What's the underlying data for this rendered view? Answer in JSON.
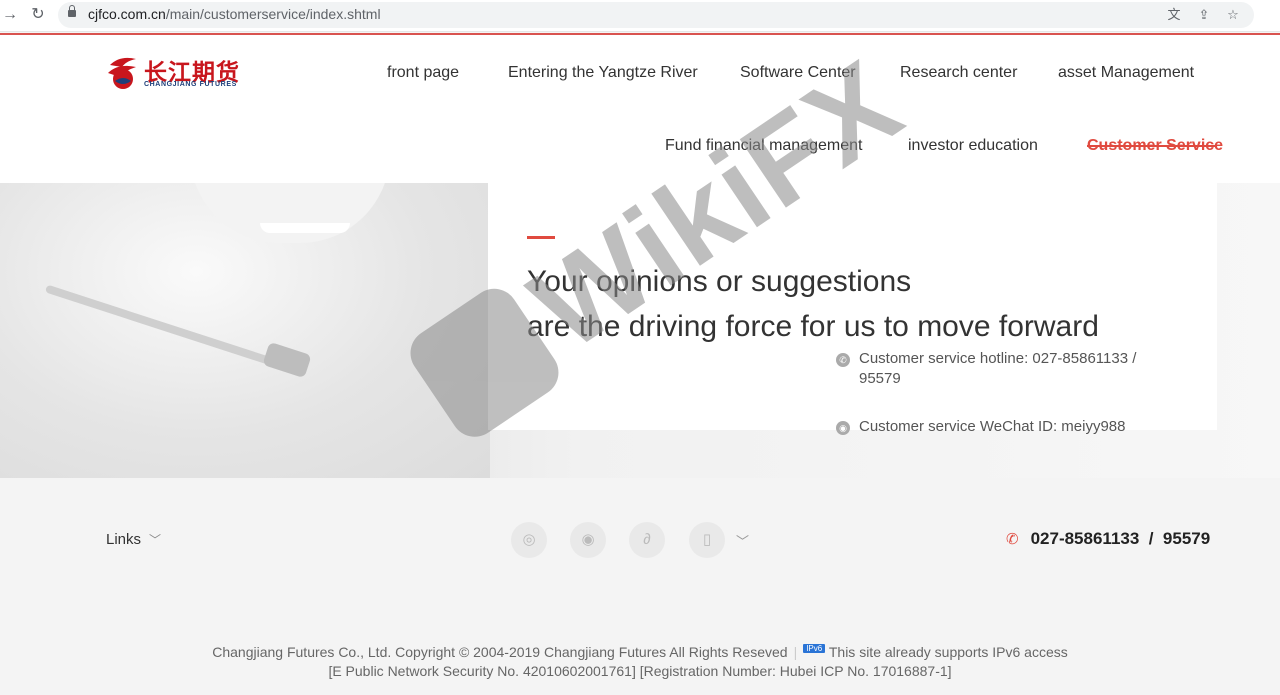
{
  "browser": {
    "url_domain": "cjfco.com.cn",
    "url_path": "/main/customerservice/index.shtml"
  },
  "logo": {
    "text": "长江期货",
    "sub": "CHANGJIANG FUTURES"
  },
  "nav": {
    "row1": [
      "front page",
      "Entering the Yangtze River",
      "Software Center",
      "Research center",
      "asset Management"
    ],
    "row2": [
      "Fund financial management",
      "investor education",
      "Customer Service"
    ],
    "active": "Customer Service"
  },
  "banner": {
    "headline_line1": "Your opinions or suggestions",
    "headline_line2": "are the driving force for us to move forward",
    "hotline_label": "Customer service hotline: 027-85861133 /",
    "hotline_label_2": "95579",
    "wechat_label": "Customer service WeChat ID: meiyy988"
  },
  "footer": {
    "links_label": "Links",
    "hotline": "027-85861133  /  95579",
    "copyright": "Changjiang Futures Co., Ltd. Copyright © 2004-2019 Changjiang Futures All Rights Reseved",
    "ipv6_badge": "IPv6",
    "ipv6_text": "This site already supports IPv6 access",
    "registration": "[E Public Network Security No. 42010602001761] [Registration Number: Hubei ICP No. 17016887-1]"
  },
  "watermark": {
    "text": "WikiFX"
  },
  "colors": {
    "accent": "#e04a3f",
    "logo_red": "#c8161d",
    "logo_blue": "#1d3f7a"
  },
  "icons": {
    "social": [
      "weibo-icon",
      "wechat-icon",
      "link-icon",
      "mobile-icon"
    ],
    "hotline": "phone-icon"
  }
}
